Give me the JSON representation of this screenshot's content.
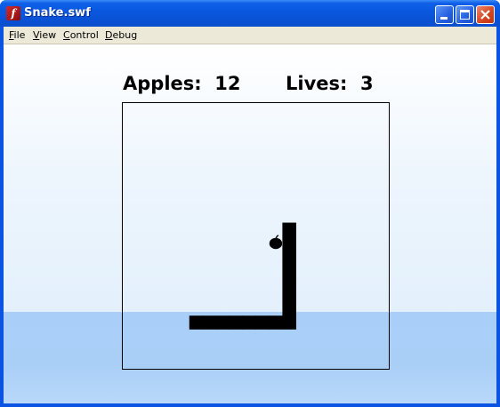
{
  "window": {
    "title": "Snake.swf",
    "icon": "flash-player-icon",
    "controls": [
      "minimize",
      "maximize",
      "close"
    ]
  },
  "menubar": {
    "items": [
      "File",
      "View",
      "Control",
      "Debug"
    ]
  },
  "hud": {
    "apples_label": "Apples:",
    "apples_value": "12",
    "lives_label": "Lives:",
    "lives_value": "3"
  },
  "game": {
    "grid_cells": 20,
    "snake_color": "#000000",
    "apple_color": "#000000",
    "snake_segments": [
      [
        5,
        16
      ],
      [
        6,
        16
      ],
      [
        7,
        16
      ],
      [
        8,
        16
      ],
      [
        9,
        16
      ],
      [
        10,
        16
      ],
      [
        11,
        16
      ],
      [
        12,
        16
      ],
      [
        12,
        15
      ],
      [
        12,
        14
      ],
      [
        12,
        13
      ],
      [
        12,
        12
      ],
      [
        12,
        11
      ],
      [
        12,
        10
      ],
      [
        12,
        9
      ]
    ],
    "apple_cell": [
      11,
      10
    ]
  }
}
